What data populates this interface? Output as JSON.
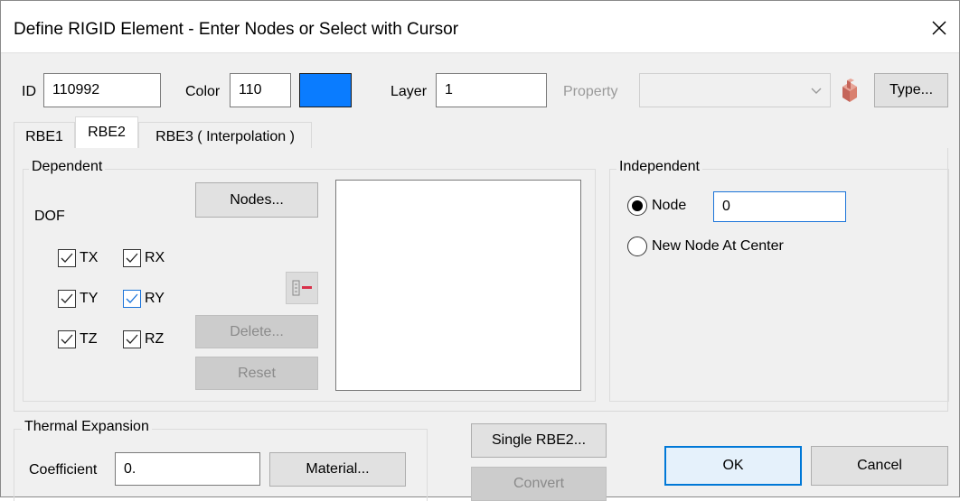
{
  "window": {
    "title": "Define RIGID Element - Enter Nodes or Select with Cursor",
    "close_icon": "close-icon"
  },
  "header": {
    "id_label": "ID",
    "id_value": "110992",
    "color_label": "Color",
    "color_value": "110",
    "color_swatch": "#0a7cff",
    "layer_label": "Layer",
    "layer_value": "1",
    "property_label": "Property",
    "property_value": "",
    "property_dropdown_icon": "chevron-down-icon",
    "property_picker_icon": "property-pick-icon",
    "type_button": "Type..."
  },
  "tabs": [
    {
      "label": "RBE1",
      "active": false
    },
    {
      "label": "RBE2",
      "active": true
    },
    {
      "label": "RBE3 ( Interpolation )",
      "active": false
    }
  ],
  "dependent": {
    "group_title": "Dependent",
    "dof_label": "DOF",
    "checkboxes": [
      {
        "label": "TX",
        "checked": true
      },
      {
        "label": "RX",
        "checked": true
      },
      {
        "label": "TY",
        "checked": true
      },
      {
        "label": "RY",
        "checked": true
      },
      {
        "label": "TZ",
        "checked": true
      },
      {
        "label": "RZ",
        "checked": true
      }
    ],
    "nodes_button": "Nodes...",
    "remove_icon": "list-remove-icon",
    "delete_button": "Delete...",
    "reset_button": "Reset",
    "node_list": []
  },
  "independent": {
    "group_title": "Independent",
    "node_radio_label": "Node",
    "node_value": "0",
    "center_radio_label": "New Node At Center",
    "selected": "Node"
  },
  "thermal": {
    "group_title": "Thermal Expansion",
    "coefficient_label": "Coefficient",
    "coefficient_value": "0.",
    "material_button": "Material..."
  },
  "actions": {
    "single_rbe2_button": "Single RBE2...",
    "convert_button": "Convert",
    "ok_button": "OK",
    "cancel_button": "Cancel"
  }
}
